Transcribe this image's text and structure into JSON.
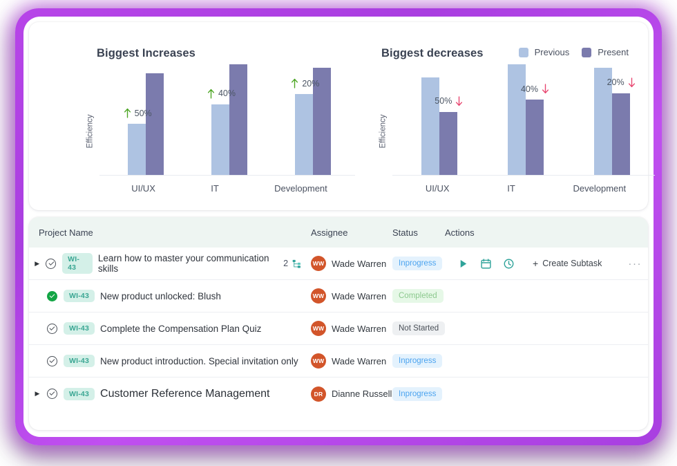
{
  "charts": {
    "legend": [
      {
        "label": "Previous",
        "color": "#aec3e2",
        "name": "previous"
      },
      {
        "label": "Present",
        "color": "#7b7bad",
        "name": "present"
      }
    ],
    "left": {
      "title": "Biggest Increases",
      "ylabel": "Efficiency"
    },
    "right": {
      "title": "Biggest decreases",
      "ylabel": "Efficiency"
    }
  },
  "chart_data": [
    {
      "type": "bar",
      "title": "Biggest Increases",
      "xlabel": "",
      "ylabel": "Efficiency",
      "categories": [
        "UI/UX",
        "IT",
        "Development"
      ],
      "series": [
        {
          "name": "Previous",
          "color": "#aec3e2",
          "values": [
            46,
            64,
            73
          ]
        },
        {
          "name": "Present",
          "color": "#7b7bad",
          "values": [
            92,
            100,
            97
          ]
        }
      ],
      "annotations": [
        "50%",
        "40%",
        "20%"
      ],
      "annotation_direction": "up",
      "annotation_color": "#4aa421",
      "ylim": [
        0,
        110
      ],
      "grid": false,
      "legend_position": "top-right"
    },
    {
      "type": "bar",
      "title": "Biggest decreases",
      "xlabel": "",
      "ylabel": "Efficiency",
      "categories": [
        "UI/UX",
        "IT",
        "Development"
      ],
      "series": [
        {
          "name": "Previous",
          "color": "#aec3e2",
          "values": [
            88,
            100,
            97
          ]
        },
        {
          "name": "Present",
          "color": "#7b7bad",
          "values": [
            57,
            68,
            74
          ]
        }
      ],
      "annotations": [
        "50%",
        "40%",
        "20%"
      ],
      "annotation_direction": "down",
      "annotation_color": "#e8456f",
      "ylim": [
        0,
        110
      ],
      "grid": false,
      "legend_position": "top-right"
    }
  ],
  "table": {
    "columns": {
      "name": "Project Name",
      "assignee": "Assignee",
      "status": "Status",
      "actions": "Actions"
    },
    "actions": {
      "create_subtask": "Create Subtask",
      "plus": "+",
      "more": "···"
    },
    "rows": [
      {
        "expandable": true,
        "check": "open",
        "key": "WI-43",
        "title": "Learn how to master your communication skills",
        "title_size": "normal",
        "subtask_count": "2",
        "assignee": "Wade Warren",
        "initials": "WW",
        "avatar_color": "#d2552a",
        "status": "Inprogress",
        "status_kind": "inprogress",
        "show_actions": true
      },
      {
        "expandable": false,
        "check": "done",
        "key": "WI-43",
        "title": "New product unlocked: Blush",
        "title_size": "normal",
        "subtask_count": "",
        "assignee": "Wade Warren",
        "initials": "WW",
        "avatar_color": "#d2552a",
        "status": "Completed",
        "status_kind": "completed",
        "show_actions": false
      },
      {
        "expandable": false,
        "check": "open",
        "key": "WI-43",
        "title": "Complete the Compensation Plan Quiz",
        "title_size": "normal",
        "subtask_count": "",
        "assignee": "Wade Warren",
        "initials": "WW",
        "avatar_color": "#d2552a",
        "status": "Not Started",
        "status_kind": "notstarted",
        "show_actions": false
      },
      {
        "expandable": false,
        "check": "open",
        "key": "WI-43",
        "title": "New product introduction. Special invitation only",
        "title_size": "normal",
        "subtask_count": "",
        "assignee": "Wade Warren",
        "initials": "WW",
        "avatar_color": "#d2552a",
        "status": "Inprogress",
        "status_kind": "inprogress",
        "show_actions": false
      },
      {
        "expandable": true,
        "check": "open",
        "key": "WI-43",
        "title": "Customer Reference Management",
        "title_size": "big",
        "subtask_count": "",
        "assignee": "Dianne Russell",
        "initials": "DR",
        "avatar_color": "#d2552a",
        "status": "Inprogress",
        "status_kind": "inprogress",
        "show_actions": false
      }
    ]
  }
}
